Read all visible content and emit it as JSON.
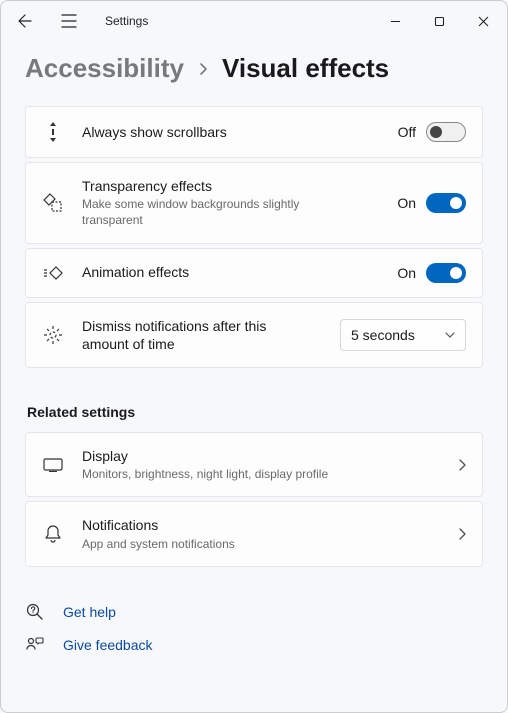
{
  "titlebar": {
    "title": "Settings"
  },
  "breadcrumb": {
    "parent": "Accessibility",
    "current": "Visual effects"
  },
  "settings": {
    "scrollbars": {
      "title": "Always show scrollbars",
      "state_label": "Off",
      "on": false
    },
    "transparency": {
      "title": "Transparency effects",
      "sub": "Make some window backgrounds slightly transparent",
      "state_label": "On",
      "on": true
    },
    "animation": {
      "title": "Animation effects",
      "state_label": "On",
      "on": true
    },
    "dismiss": {
      "title": "Dismiss notifications after this amount of time",
      "selected": "5 seconds"
    }
  },
  "related": {
    "header": "Related settings",
    "display": {
      "title": "Display",
      "sub": "Monitors, brightness, night light, display profile"
    },
    "notifications": {
      "title": "Notifications",
      "sub": "App and system notifications"
    }
  },
  "help": {
    "get_help": "Get help",
    "feedback": "Give feedback"
  }
}
